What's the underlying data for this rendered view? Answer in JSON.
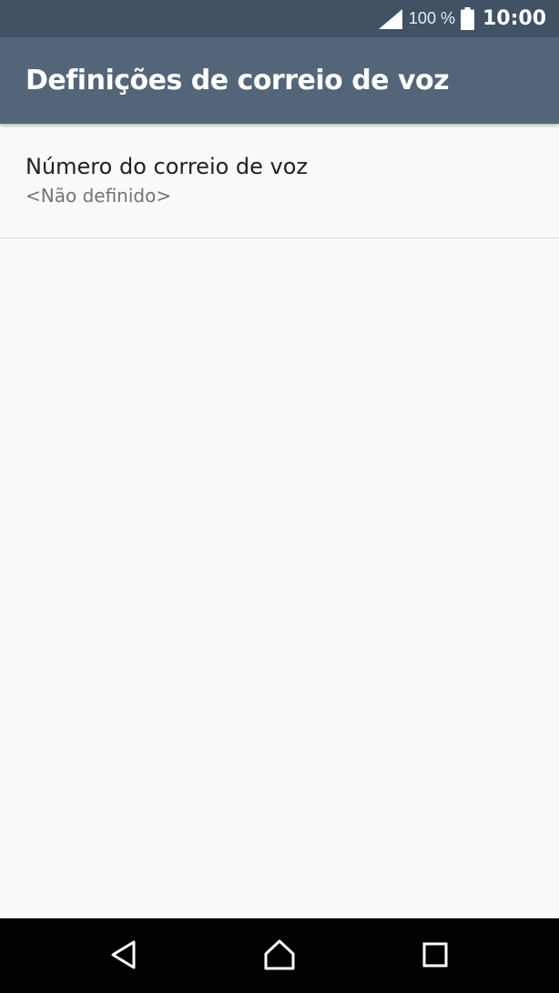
{
  "status_bar": {
    "battery_percent_label": "100 %",
    "time": "10:00",
    "icons": [
      "signal-icon",
      "battery-icon"
    ]
  },
  "app_bar": {
    "title": "Definições de correio de voz"
  },
  "settings": {
    "items": [
      {
        "title": "Número do correio de voz",
        "summary": "<Não definido>"
      }
    ]
  },
  "nav_bar": {
    "icons": [
      "back-icon",
      "home-icon",
      "recents-icon"
    ]
  },
  "colors": {
    "status_bar": "#405264",
    "app_bar": "#536679",
    "background": "#fafafa",
    "nav_bar": "#000000"
  }
}
